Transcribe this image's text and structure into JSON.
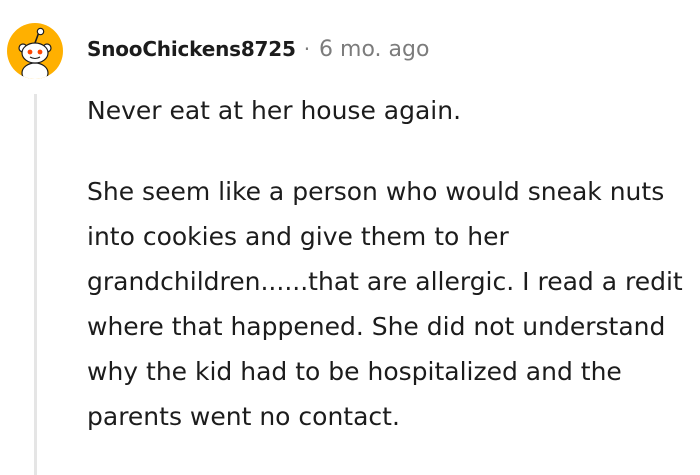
{
  "comment": {
    "avatar_icon": "reddit-snoo-icon",
    "avatar_color": "#ffb000",
    "username": "SnooChickens8725",
    "separator": "·",
    "timestamp": "6 mo. ago",
    "paragraphs": [
      "Never eat at her house again.",
      "She seem like a person who would sneak nuts into cookies and give them to her grandchildren......that are allergic. I read a redit where that happened. She did not understand why the kid had to be hospitalized and the parents went no contact."
    ]
  }
}
